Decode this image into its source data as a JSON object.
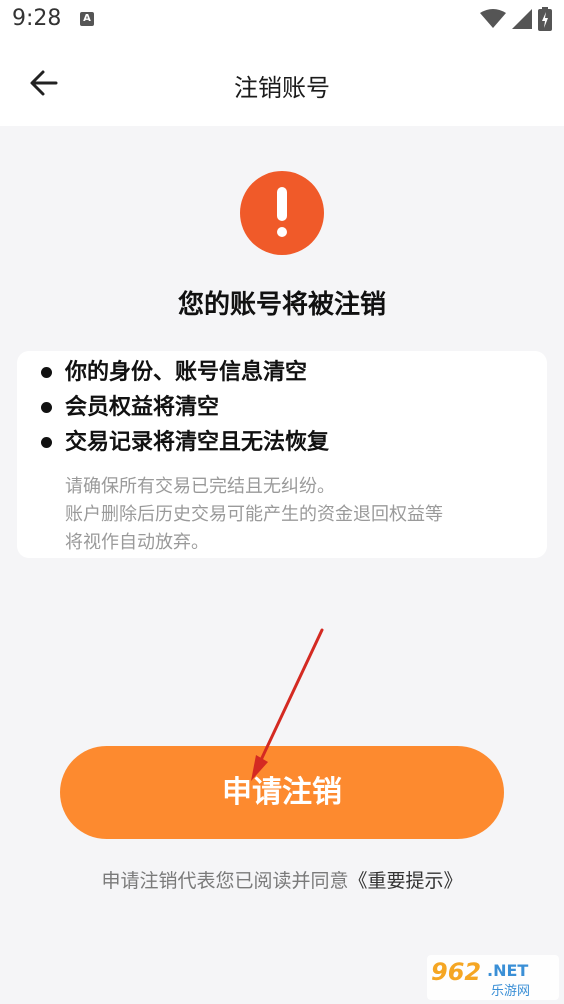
{
  "status_bar": {
    "time": "9:28",
    "notification_icon": "a-notification-icon",
    "icons": [
      "wifi-icon",
      "signal-icon",
      "battery-icon"
    ]
  },
  "app_bar": {
    "title": "注销账号",
    "back_icon": "back-arrow-icon"
  },
  "warning": {
    "icon": "exclamation-icon",
    "color": "#f05a29",
    "heading": "您的账号将被注销"
  },
  "consequences": {
    "items": [
      "你的身份、账号信息清空",
      "会员权益将清空",
      "交易记录将清空且无法恢复"
    ],
    "notes": [
      "请确保所有交易已完结且无纠纷。",
      "账户删除后历史交易可能产生的资金退回权益等",
      "将视作自动放弃。"
    ]
  },
  "action": {
    "label": "申请注销",
    "color": "#fd8a2f"
  },
  "agreement": {
    "text": "申请注销代表您已阅读并同意",
    "link_text": "《重要提示》"
  },
  "annotation": {
    "arrow_color": "#d42a22"
  },
  "watermark": {
    "text_main": "962",
    "text_suffix": ".NET",
    "text_sub": "乐游网"
  }
}
